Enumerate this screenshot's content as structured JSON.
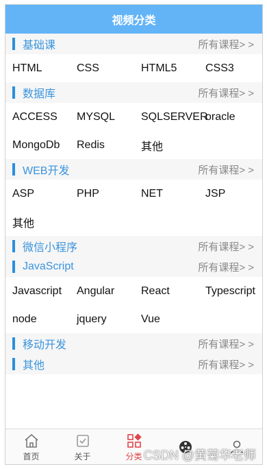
{
  "header": {
    "title": "视频分类"
  },
  "more_label": "所有课程> >",
  "sections": [
    {
      "title": "基础课",
      "items": [
        "HTML",
        "CSS",
        "HTML5",
        "CSS3"
      ]
    },
    {
      "title": "数据库",
      "items": [
        "ACCESS",
        "MYSQL",
        "SQLSERVER",
        "oracle",
        "MongoDb",
        "Redis",
        "其他"
      ]
    },
    {
      "title": "WEB开发",
      "items": [
        "ASP",
        "PHP",
        "NET",
        "JSP",
        "其他"
      ]
    },
    {
      "title": "微信小程序",
      "items": []
    },
    {
      "title": "JavaScript",
      "items": [
        "Javascript",
        "Angular",
        "React",
        "Typescript",
        "node",
        "jquery",
        "Vue"
      ]
    },
    {
      "title": "移动开发",
      "items": []
    },
    {
      "title": "其他",
      "items": []
    }
  ],
  "tabbar": {
    "tabs": [
      {
        "label": "首页",
        "icon": "home-icon"
      },
      {
        "label": "关于",
        "icon": "checkbox-icon"
      },
      {
        "label": "分类",
        "icon": "category-icon",
        "active": true
      },
      {
        "label": "",
        "icon": "film-reel-icon"
      },
      {
        "label": "",
        "icon": "user-icon"
      }
    ],
    "active_color": "#e0454a"
  },
  "watermark": "CSDN @黄菊华老师",
  "colors": {
    "header": "#63b4f7",
    "accent": "#2a8fe0",
    "section_title": "#3a94de"
  }
}
